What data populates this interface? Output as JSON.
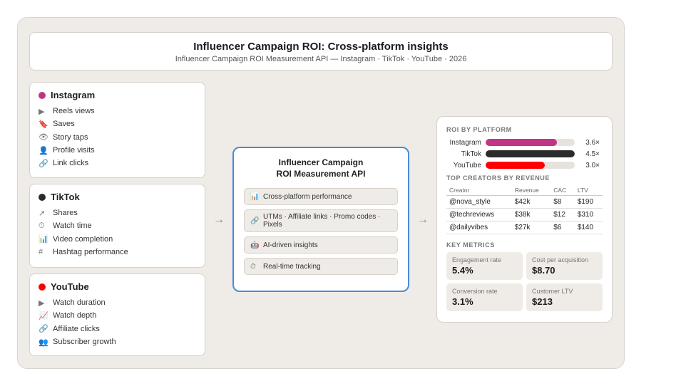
{
  "header": {
    "title": "Influencer Campaign ROI: Cross-platform insights",
    "subtitle": "Influencer Campaign ROI Measurement API — Instagram · TikTok · YouTube · 2026"
  },
  "platforms": [
    {
      "name": "Instagram",
      "color": "#c13584",
      "items": [
        {
          "icon": "play-icon",
          "glyph": "▶",
          "label": "Reels views"
        },
        {
          "icon": "bookmark-icon",
          "glyph": "🔖",
          "label": "Saves"
        },
        {
          "icon": "eye-icon",
          "glyph": "👁",
          "label": "Story taps"
        },
        {
          "icon": "user-icon",
          "glyph": "👤",
          "label": "Profile visits"
        },
        {
          "icon": "link-icon",
          "glyph": "🔗",
          "label": "Link clicks"
        }
      ]
    },
    {
      "name": "TikTok",
      "color": "#2b2b2b",
      "items": [
        {
          "icon": "share-icon",
          "glyph": "↗",
          "label": "Shares"
        },
        {
          "icon": "stopwatch-icon",
          "glyph": "⏱",
          "label": "Watch time"
        },
        {
          "icon": "bar-chart-icon",
          "glyph": "📊",
          "label": "Video completion"
        },
        {
          "icon": "hashtag-icon",
          "glyph": "#",
          "label": "Hashtag performance"
        }
      ]
    },
    {
      "name": "YouTube",
      "color": "#ff0000",
      "items": [
        {
          "icon": "play-icon",
          "glyph": "▶",
          "label": "Watch duration"
        },
        {
          "icon": "trend-chart-icon",
          "glyph": "📈",
          "label": "Watch depth"
        },
        {
          "icon": "link-icon",
          "glyph": "🔗",
          "label": "Affiliate clicks"
        },
        {
          "icon": "users-icon",
          "glyph": "👥",
          "label": "Subscriber growth"
        }
      ]
    }
  ],
  "arrows": {
    "left": "→",
    "right": "→"
  },
  "api": {
    "title_line1": "Influencer Campaign",
    "title_line2": "ROI Measurement API",
    "features": [
      {
        "icon": "bar-chart-icon",
        "glyph": "📊",
        "label": "Cross-platform performance"
      },
      {
        "icon": "link-icon",
        "glyph": "🔗",
        "label": "UTMs · Affiliate links · Promo codes · Pixels"
      },
      {
        "icon": "robot-icon",
        "glyph": "🤖",
        "label": "AI-driven insights"
      },
      {
        "icon": "stopwatch-icon",
        "glyph": "⏱",
        "label": "Real-time tracking"
      }
    ]
  },
  "roi": {
    "label": "ROI BY PLATFORM",
    "max": 4.5,
    "rows": [
      {
        "name": "Instagram",
        "value": 3.6,
        "display": "3.6×",
        "color": "#c13584"
      },
      {
        "name": "TikTok",
        "value": 4.5,
        "display": "4.5×",
        "color": "#2b2b2b"
      },
      {
        "name": "YouTube",
        "value": 3.0,
        "display": "3.0×",
        "color": "#ff0000"
      }
    ]
  },
  "creators": {
    "label": "TOP CREATORS BY REVENUE",
    "columns": [
      "Creator",
      "Revenue",
      "CAC",
      "LTV"
    ],
    "rows": [
      [
        "@nova_style",
        "$42k",
        "$8",
        "$190"
      ],
      [
        "@techreviews",
        "$38k",
        "$12",
        "$310"
      ],
      [
        "@dailyvibes",
        "$27k",
        "$6",
        "$140"
      ]
    ]
  },
  "metrics": {
    "label": "KEY METRICS",
    "items": [
      {
        "label": "Engagement rate",
        "value": "5.4%"
      },
      {
        "label": "Cost per acquisition",
        "value": "$8.70"
      },
      {
        "label": "Conversion rate",
        "value": "3.1%"
      },
      {
        "label": "Customer LTV",
        "value": "$213"
      }
    ]
  }
}
